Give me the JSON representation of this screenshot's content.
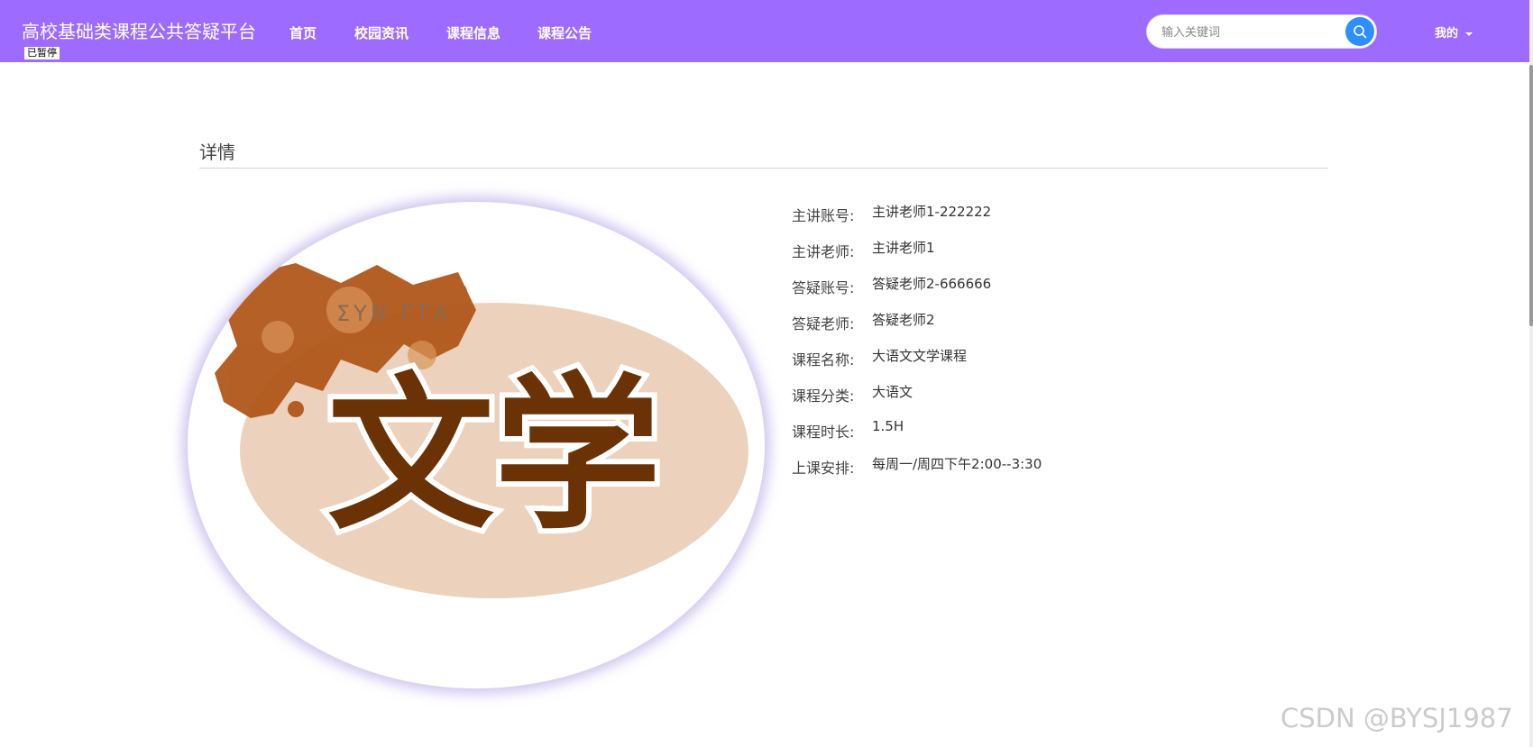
{
  "header": {
    "site_title": "高校基础类课程公共答疑平台",
    "paused_badge": "已暂停",
    "nav": [
      {
        "label": "首页"
      },
      {
        "label": "校园资讯"
      },
      {
        "label": "课程信息"
      },
      {
        "label": "课程公告"
      }
    ],
    "search": {
      "placeholder": "输入关键词",
      "icon": "search-icon"
    },
    "user_menu": {
      "label": "我的",
      "icon": "caret-down-icon"
    },
    "colors": {
      "header_bg": "#9d6bff",
      "search_button": "#2f8fff"
    }
  },
  "detail": {
    "section_title": "详情",
    "image": {
      "text": "文学",
      "overlay_text": "ΣΥΝ ΓΤΑ"
    },
    "fields": [
      {
        "label": "主讲账号:",
        "value": "主讲老师1-222222"
      },
      {
        "label": "主讲老师:",
        "value": "主讲老师1"
      },
      {
        "label": "答疑账号:",
        "value": "答疑老师2-666666"
      },
      {
        "label": "答疑老师:",
        "value": "答疑老师2"
      },
      {
        "label": "课程名称:",
        "value": "大语文文学课程"
      },
      {
        "label": "课程分类:",
        "value": "大语文"
      },
      {
        "label": "课程时长:",
        "value": "1.5H"
      },
      {
        "label": "上课安排:",
        "value": "每周一/周四下午2:00--3:30"
      }
    ]
  },
  "watermark": "CSDN @BYSJ1987"
}
